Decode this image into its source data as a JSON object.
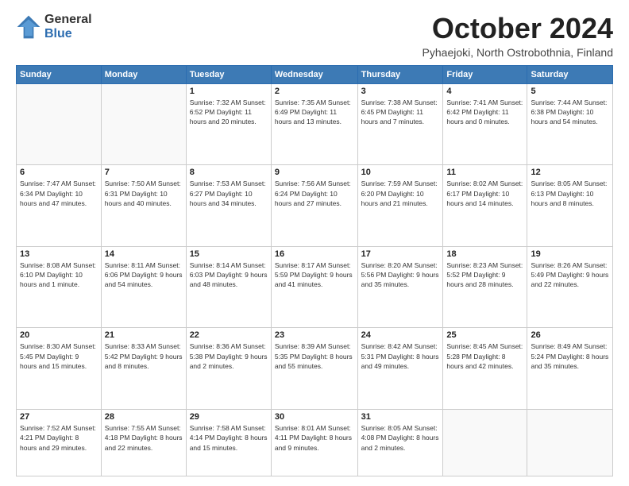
{
  "logo": {
    "general": "General",
    "blue": "Blue"
  },
  "title": "October 2024",
  "subtitle": "Pyhaejoki, North Ostrobothnia, Finland",
  "days_of_week": [
    "Sunday",
    "Monday",
    "Tuesday",
    "Wednesday",
    "Thursday",
    "Friday",
    "Saturday"
  ],
  "weeks": [
    [
      {
        "day": "",
        "info": ""
      },
      {
        "day": "",
        "info": ""
      },
      {
        "day": "1",
        "info": "Sunrise: 7:32 AM\nSunset: 6:52 PM\nDaylight: 11 hours\nand 20 minutes."
      },
      {
        "day": "2",
        "info": "Sunrise: 7:35 AM\nSunset: 6:49 PM\nDaylight: 11 hours\nand 13 minutes."
      },
      {
        "day": "3",
        "info": "Sunrise: 7:38 AM\nSunset: 6:45 PM\nDaylight: 11 hours\nand 7 minutes."
      },
      {
        "day": "4",
        "info": "Sunrise: 7:41 AM\nSunset: 6:42 PM\nDaylight: 11 hours\nand 0 minutes."
      },
      {
        "day": "5",
        "info": "Sunrise: 7:44 AM\nSunset: 6:38 PM\nDaylight: 10 hours\nand 54 minutes."
      }
    ],
    [
      {
        "day": "6",
        "info": "Sunrise: 7:47 AM\nSunset: 6:34 PM\nDaylight: 10 hours\nand 47 minutes."
      },
      {
        "day": "7",
        "info": "Sunrise: 7:50 AM\nSunset: 6:31 PM\nDaylight: 10 hours\nand 40 minutes."
      },
      {
        "day": "8",
        "info": "Sunrise: 7:53 AM\nSunset: 6:27 PM\nDaylight: 10 hours\nand 34 minutes."
      },
      {
        "day": "9",
        "info": "Sunrise: 7:56 AM\nSunset: 6:24 PM\nDaylight: 10 hours\nand 27 minutes."
      },
      {
        "day": "10",
        "info": "Sunrise: 7:59 AM\nSunset: 6:20 PM\nDaylight: 10 hours\nand 21 minutes."
      },
      {
        "day": "11",
        "info": "Sunrise: 8:02 AM\nSunset: 6:17 PM\nDaylight: 10 hours\nand 14 minutes."
      },
      {
        "day": "12",
        "info": "Sunrise: 8:05 AM\nSunset: 6:13 PM\nDaylight: 10 hours\nand 8 minutes."
      }
    ],
    [
      {
        "day": "13",
        "info": "Sunrise: 8:08 AM\nSunset: 6:10 PM\nDaylight: 10 hours\nand 1 minute."
      },
      {
        "day": "14",
        "info": "Sunrise: 8:11 AM\nSunset: 6:06 PM\nDaylight: 9 hours\nand 54 minutes."
      },
      {
        "day": "15",
        "info": "Sunrise: 8:14 AM\nSunset: 6:03 PM\nDaylight: 9 hours\nand 48 minutes."
      },
      {
        "day": "16",
        "info": "Sunrise: 8:17 AM\nSunset: 5:59 PM\nDaylight: 9 hours\nand 41 minutes."
      },
      {
        "day": "17",
        "info": "Sunrise: 8:20 AM\nSunset: 5:56 PM\nDaylight: 9 hours\nand 35 minutes."
      },
      {
        "day": "18",
        "info": "Sunrise: 8:23 AM\nSunset: 5:52 PM\nDaylight: 9 hours\nand 28 minutes."
      },
      {
        "day": "19",
        "info": "Sunrise: 8:26 AM\nSunset: 5:49 PM\nDaylight: 9 hours\nand 22 minutes."
      }
    ],
    [
      {
        "day": "20",
        "info": "Sunrise: 8:30 AM\nSunset: 5:45 PM\nDaylight: 9 hours\nand 15 minutes."
      },
      {
        "day": "21",
        "info": "Sunrise: 8:33 AM\nSunset: 5:42 PM\nDaylight: 9 hours\nand 8 minutes."
      },
      {
        "day": "22",
        "info": "Sunrise: 8:36 AM\nSunset: 5:38 PM\nDaylight: 9 hours\nand 2 minutes."
      },
      {
        "day": "23",
        "info": "Sunrise: 8:39 AM\nSunset: 5:35 PM\nDaylight: 8 hours\nand 55 minutes."
      },
      {
        "day": "24",
        "info": "Sunrise: 8:42 AM\nSunset: 5:31 PM\nDaylight: 8 hours\nand 49 minutes."
      },
      {
        "day": "25",
        "info": "Sunrise: 8:45 AM\nSunset: 5:28 PM\nDaylight: 8 hours\nand 42 minutes."
      },
      {
        "day": "26",
        "info": "Sunrise: 8:49 AM\nSunset: 5:24 PM\nDaylight: 8 hours\nand 35 minutes."
      }
    ],
    [
      {
        "day": "27",
        "info": "Sunrise: 7:52 AM\nSunset: 4:21 PM\nDaylight: 8 hours\nand 29 minutes."
      },
      {
        "day": "28",
        "info": "Sunrise: 7:55 AM\nSunset: 4:18 PM\nDaylight: 8 hours\nand 22 minutes."
      },
      {
        "day": "29",
        "info": "Sunrise: 7:58 AM\nSunset: 4:14 PM\nDaylight: 8 hours\nand 15 minutes."
      },
      {
        "day": "30",
        "info": "Sunrise: 8:01 AM\nSunset: 4:11 PM\nDaylight: 8 hours\nand 9 minutes."
      },
      {
        "day": "31",
        "info": "Sunrise: 8:05 AM\nSunset: 4:08 PM\nDaylight: 8 hours\nand 2 minutes."
      },
      {
        "day": "",
        "info": ""
      },
      {
        "day": "",
        "info": ""
      }
    ]
  ]
}
